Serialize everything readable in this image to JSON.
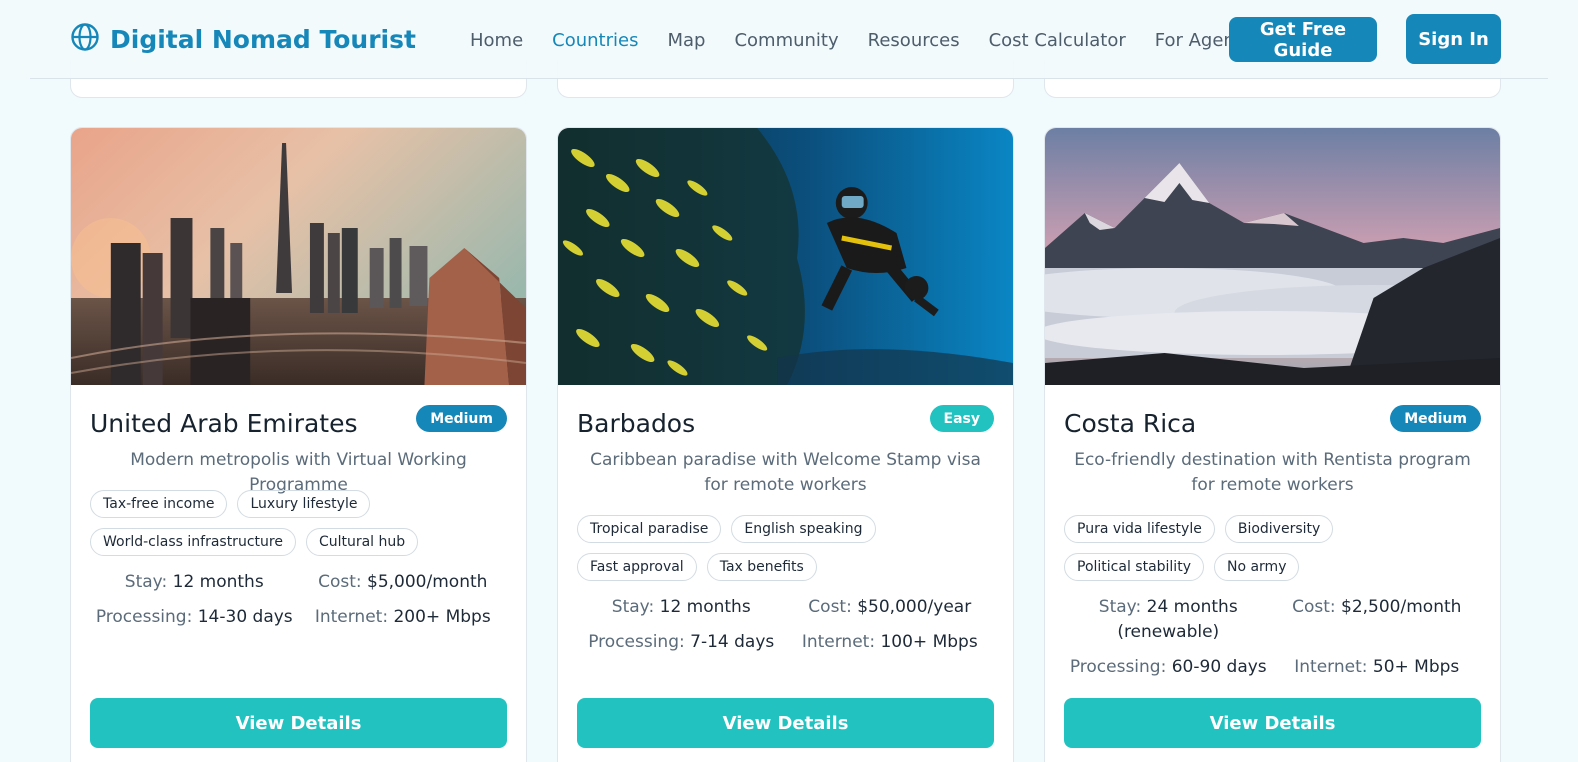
{
  "header": {
    "brand": "Digital Nomad Tourist",
    "nav": [
      "Home",
      "Countries",
      "Map",
      "Community",
      "Resources",
      "Cost Calculator",
      "For Agencies"
    ],
    "active_nav": "Countries",
    "cta_guide": "Get Free Guide",
    "cta_signin": "Sign In"
  },
  "colors": {
    "brand": "#1687b9",
    "accent": "#22c2c0",
    "background": "#f1fafc"
  },
  "labels": {
    "stay": "Stay:",
    "cost": "Cost:",
    "processing": "Processing:",
    "internet": "Internet:",
    "details_button": "View Details"
  },
  "cards": [
    {
      "title": "United Arab Emirates",
      "badge": "Medium",
      "description": "Modern metropolis with Virtual Working Programme",
      "tags": [
        "Tax-free income",
        "Luxury lifestyle",
        "World-class infrastructure",
        "Cultural hub"
      ],
      "stay": "12 months",
      "cost": "$5,000/month",
      "processing": "14-30 days",
      "internet": "200+ Mbps",
      "image": "dubai-skyline-photo"
    },
    {
      "title": "Barbados",
      "badge": "Easy",
      "description": "Caribbean paradise with Welcome Stamp visa for remote workers",
      "tags": [
        "Tropical paradise",
        "English speaking",
        "Fast approval",
        "Tax benefits"
      ],
      "stay": "12 months",
      "cost": "$50,000/year",
      "processing": "7-14 days",
      "internet": "100+ Mbps",
      "image": "scuba-diver-reef-photo"
    },
    {
      "title": "Costa Rica",
      "badge": "Medium",
      "description": "Eco-friendly destination with Rentista program for remote workers",
      "tags": [
        "Pura vida lifestyle",
        "Biodiversity",
        "Political stability",
        "No army"
      ],
      "stay": "24 months (renewable)",
      "cost": "$2,500/month",
      "processing": "60-90 days",
      "internet": "50+ Mbps",
      "image": "mountains-above-clouds-photo"
    }
  ]
}
